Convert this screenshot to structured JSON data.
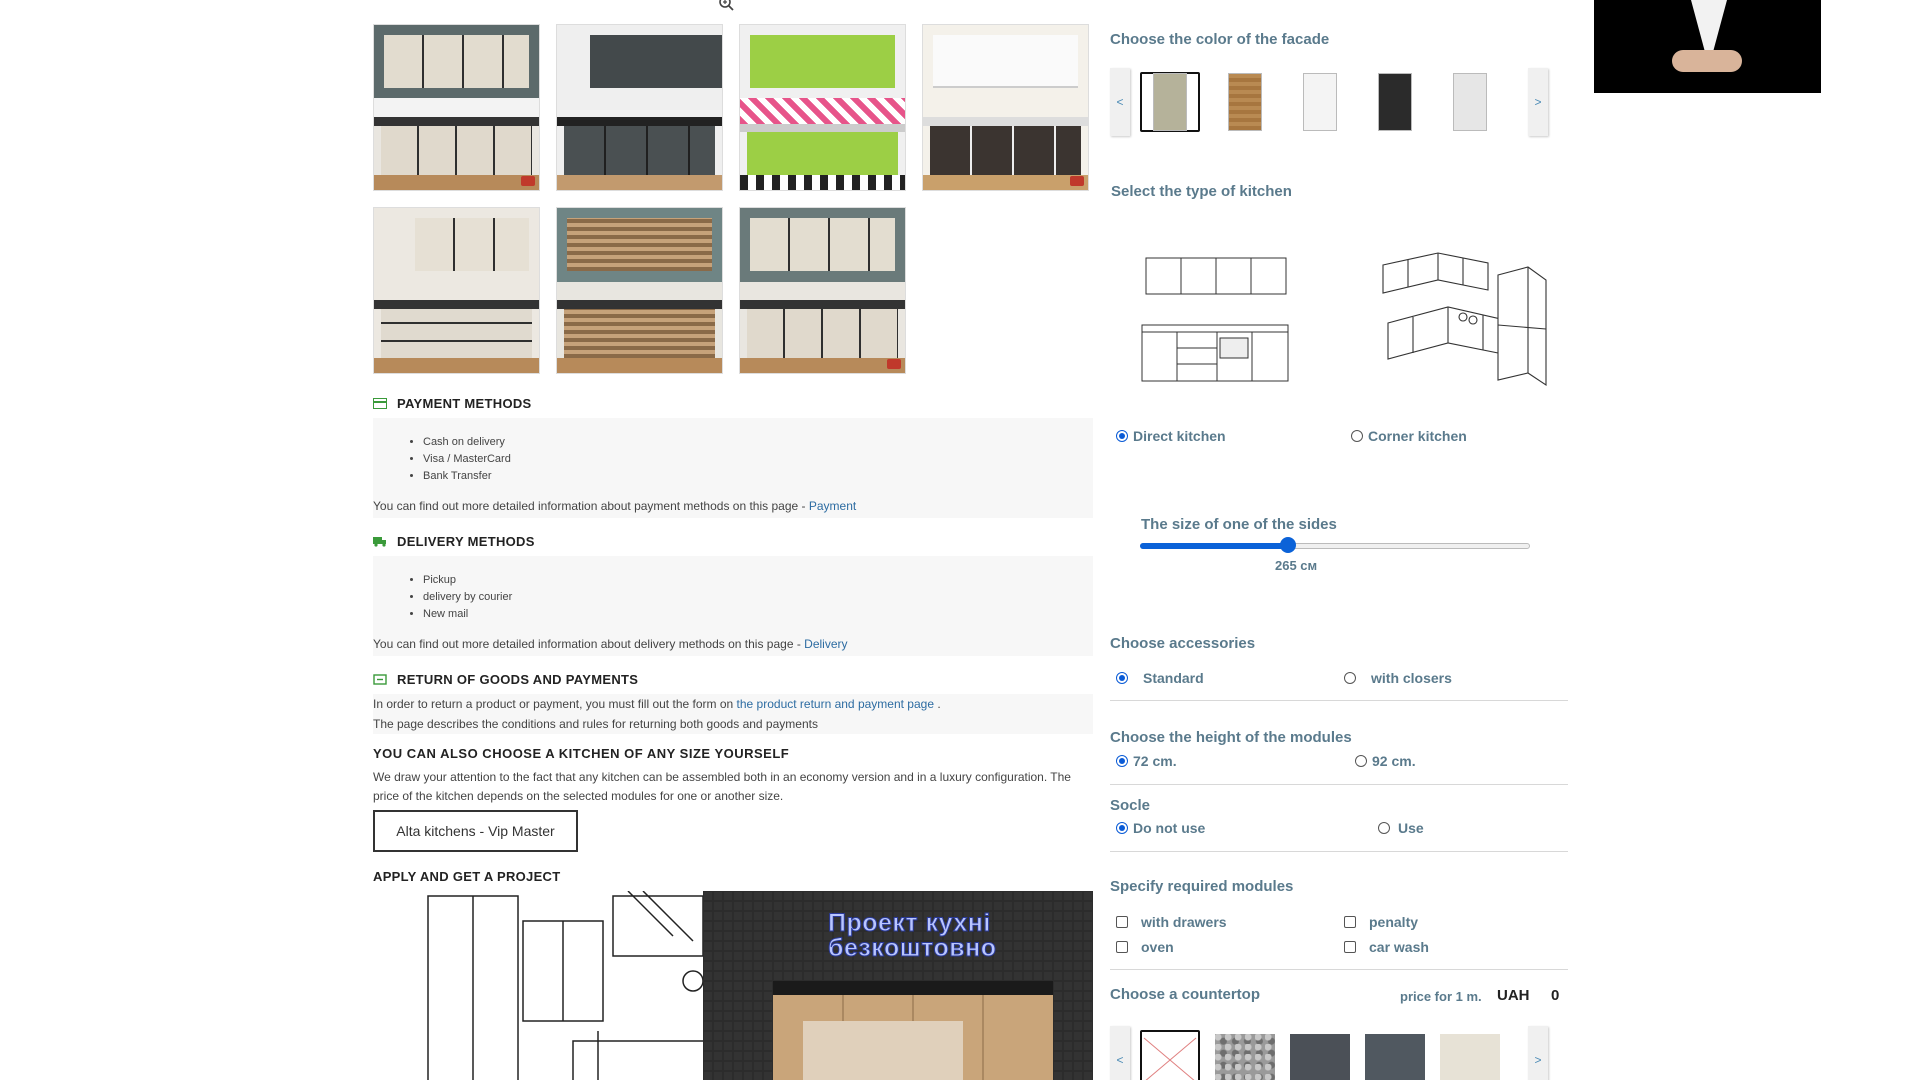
{
  "colors": {
    "accent": "#5a7a8c",
    "link": "#2d6ca2",
    "radio_active": "#0a5bd6"
  },
  "gallery": {
    "zoom_icon": "zoom-icon",
    "images": [
      {
        "scheme": "light-beige"
      },
      {
        "scheme": "dark-grey"
      },
      {
        "scheme": "lime-green"
      },
      {
        "scheme": "white-corner"
      },
      {
        "scheme": "light-oven"
      },
      {
        "scheme": "wood-stripe"
      },
      {
        "scheme": "light-dark"
      }
    ]
  },
  "payment": {
    "title": "PAYMENT METHODS",
    "items": [
      "Cash on delivery",
      "Visa / MasterCard",
      "Bank Transfer"
    ],
    "info": "You can find out more detailed information about payment methods on this page -",
    "link": "Payment"
  },
  "delivery": {
    "title": "DELIVERY METHODS",
    "items": [
      "Pickup",
      "delivery by courier",
      "New mail"
    ],
    "info": "You can find out more detailed information about delivery methods on this page -",
    "link": "Delivery"
  },
  "returns": {
    "title": "RETURN OF GOODS AND PAYMENTS",
    "line1": "In order to return a product or payment, you must fill out the form on",
    "link": "the product return and payment page",
    "line1_end": ".",
    "line2": "The page describes the conditions and rules for returning both goods and payments"
  },
  "choose_size": {
    "title": "YOU CAN ALSO CHOOSE A KITCHEN OF ANY SIZE YOURSELF",
    "text": "We draw your attention to the fact that any kitchen can be assembled both in an economy version and in a luxury configuration. The price of the kitchen depends on the selected modules for one or another size.",
    "button": "Alta kitchens - Vip Master"
  },
  "apply": {
    "title": "APPLY AND GET A PROJECT",
    "banner_line1": "Проект кухні",
    "banner_line2": "безкоштовно"
  },
  "facade": {
    "title": "Choose the color of the facade",
    "prev": "<",
    "next": ">",
    "swatches": [
      {
        "name": "beige-grey",
        "color": "#b5b29a",
        "selected": true
      },
      {
        "name": "oak",
        "color": "#a7763f",
        "selected": false
      },
      {
        "name": "white",
        "color": "#f4f4f4",
        "selected": false
      },
      {
        "name": "black",
        "color": "#2b2b2b",
        "selected": false
      },
      {
        "name": "light-grey",
        "color": "#e6e6e6",
        "selected": false
      }
    ]
  },
  "kitchen_type": {
    "title": "Select the type of kitchen",
    "options": [
      {
        "label": "Direct kitchen",
        "selected": true
      },
      {
        "label": "Corner kitchen",
        "selected": false
      }
    ]
  },
  "side_size": {
    "title": "The size of one of the sides",
    "value_label": "265 см",
    "fraction": 0.38
  },
  "accessories": {
    "title": "Choose accessories",
    "options": [
      {
        "label": "Standard",
        "selected": true
      },
      {
        "label": "with closers",
        "selected": false
      }
    ]
  },
  "module_height": {
    "title": "Choose the height of the modules",
    "options": [
      {
        "label": "72 cm.",
        "selected": true
      },
      {
        "label": "92 cm.",
        "selected": false
      }
    ]
  },
  "socle": {
    "title": "Socle",
    "options": [
      {
        "label": "Do not use",
        "selected": true
      },
      {
        "label": "Use",
        "selected": false
      }
    ]
  },
  "modules": {
    "title": "Specify required modules",
    "options": [
      {
        "label": "with drawers",
        "checked": false
      },
      {
        "label": "penalty",
        "checked": false
      },
      {
        "label": "oven",
        "checked": false
      },
      {
        "label": "car wash",
        "checked": false
      }
    ]
  },
  "countertop": {
    "title": "Choose a countertop",
    "price_label": "price for 1 m.",
    "currency": "UAH",
    "price": "0",
    "prev": "<",
    "next": ">",
    "swatches": [
      {
        "name": "none",
        "color": "#ffffff",
        "selected": true
      },
      {
        "name": "granite",
        "color": "#9a9a9a",
        "selected": false
      },
      {
        "name": "dark-stone",
        "color": "#4b5057",
        "selected": false
      },
      {
        "name": "slate",
        "color": "#505860",
        "selected": false
      },
      {
        "name": "light-wood",
        "color": "#e7e2d6",
        "selected": false
      }
    ]
  }
}
